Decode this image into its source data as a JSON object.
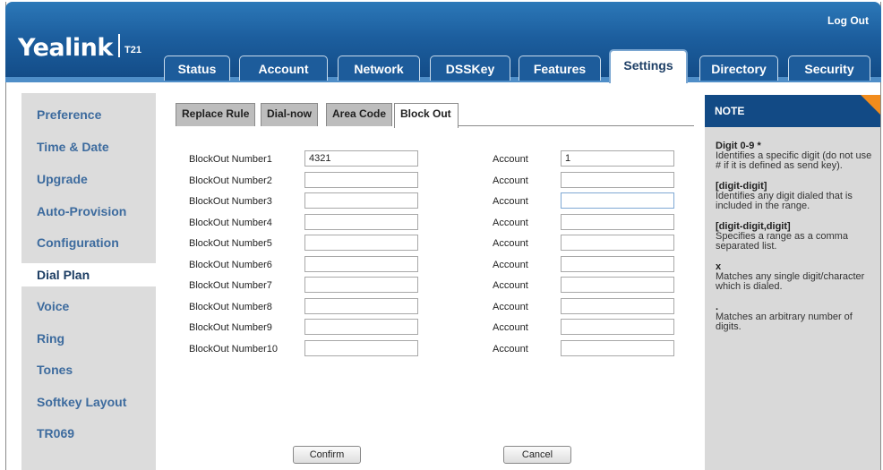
{
  "header": {
    "logo_text": "Yealink",
    "model": "T21",
    "logout_label": "Log Out",
    "tabs": [
      {
        "label": "Status"
      },
      {
        "label": "Account"
      },
      {
        "label": "Network"
      },
      {
        "label": "DSSKey"
      },
      {
        "label": "Features"
      },
      {
        "label": "Settings"
      },
      {
        "label": "Directory"
      },
      {
        "label": "Security"
      }
    ],
    "active_tab": "Settings"
  },
  "sidebar": {
    "items": [
      {
        "label": "Preference"
      },
      {
        "label": "Time & Date"
      },
      {
        "label": "Upgrade"
      },
      {
        "label": "Auto-Provision"
      },
      {
        "label": "Configuration"
      },
      {
        "label": "Dial Plan"
      },
      {
        "label": "Voice"
      },
      {
        "label": "Ring"
      },
      {
        "label": "Tones"
      },
      {
        "label": "Softkey Layout"
      },
      {
        "label": "TR069"
      }
    ],
    "active_item": "Dial Plan"
  },
  "subtabs": {
    "items": [
      {
        "label": "Replace Rule"
      },
      {
        "label": "Dial-now"
      },
      {
        "label": "Area Code"
      },
      {
        "label": "Block Out"
      }
    ],
    "active": "Block Out"
  },
  "form": {
    "rows": [
      {
        "label": "BlockOut Number1",
        "number": "4321",
        "account_label": "Account",
        "account": "1"
      },
      {
        "label": "BlockOut Number2",
        "number": "",
        "account_label": "Account",
        "account": ""
      },
      {
        "label": "BlockOut Number3",
        "number": "",
        "account_label": "Account",
        "account": ""
      },
      {
        "label": "BlockOut Number4",
        "number": "",
        "account_label": "Account",
        "account": ""
      },
      {
        "label": "BlockOut Number5",
        "number": "",
        "account_label": "Account",
        "account": ""
      },
      {
        "label": "BlockOut Number6",
        "number": "",
        "account_label": "Account",
        "account": ""
      },
      {
        "label": "BlockOut Number7",
        "number": "",
        "account_label": "Account",
        "account": ""
      },
      {
        "label": "BlockOut Number8",
        "number": "",
        "account_label": "Account",
        "account": ""
      },
      {
        "label": "BlockOut Number9",
        "number": "",
        "account_label": "Account",
        "account": ""
      },
      {
        "label": "BlockOut Number10",
        "number": "",
        "account_label": "Account",
        "account": ""
      }
    ],
    "confirm_label": "Confirm",
    "cancel_label": "Cancel"
  },
  "note": {
    "title": "NOTE",
    "entries": [
      {
        "term": "Digit 0-9 *",
        "desc": "Identifies a specific digit (do not use # if it is defined as send key)."
      },
      {
        "term": "[digit-digit]",
        "desc": "Identifies any digit dialed that is included in the range."
      },
      {
        "term": "[digit-digit,digit]",
        "desc": "Specifies a range as a comma separated list."
      },
      {
        "term": "x",
        "desc": "Matches any single digit/character which is dialed."
      },
      {
        "term": ".",
        "desc": "Matches an arbitrary number of digits."
      }
    ]
  },
  "colors": {
    "header_blue": "#124a85",
    "note_corner_orange": "#f28c1c",
    "sidebar_gray": "#dcdcdc",
    "sidebar_link": "#3d6b9e"
  }
}
